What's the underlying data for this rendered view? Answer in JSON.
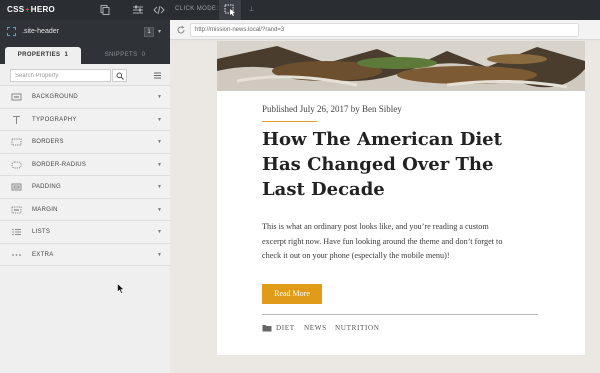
{
  "app": {
    "logo": "CSS",
    "logo_plus": "+",
    "logo_suffix": "HERO",
    "click_mode_label": "CLICK MODE:"
  },
  "panel": {
    "selector": ".site-header",
    "selector_count": "1",
    "tabs": [
      {
        "label": "PROPERTIES",
        "count": "1"
      },
      {
        "label": "SNIPPETS",
        "count": "0"
      }
    ],
    "search_placeholder": "Search Property",
    "properties": [
      {
        "label": "BACKGROUND",
        "icon": "background-icon"
      },
      {
        "label": "TYPOGRAPHY",
        "icon": "typography-icon"
      },
      {
        "label": "BORDERS",
        "icon": "borders-icon"
      },
      {
        "label": "BORDER-RADIUS",
        "icon": "border-radius-icon"
      },
      {
        "label": "PADDING",
        "icon": "padding-icon"
      },
      {
        "label": "MARGIN",
        "icon": "margin-icon"
      },
      {
        "label": "LISTS",
        "icon": "lists-icon"
      },
      {
        "label": "EXTRA",
        "icon": "extra-icon"
      }
    ]
  },
  "browser": {
    "url": "http://mission-news.local/?rand=3"
  },
  "post": {
    "meta": "Published July 26, 2017 by Ben Sibley",
    "title_lines": [
      "How The American Diet",
      "Has Changed Over The",
      "Last Decade"
    ],
    "excerpt_lines": [
      "This is what an ordinary post looks like, and you’re reading a custom",
      "excerpt right now. Have fun looking around the theme and don’t forget to",
      "check it out on your phone (especially the mobile menu)!"
    ],
    "read_more": "Read More",
    "tags": [
      "DIET",
      "NEWS",
      "NUTRITION"
    ]
  },
  "colors": {
    "accent": "#e09b18",
    "topbar": "#2a2d31",
    "selector_outline": "#4aa3df"
  }
}
